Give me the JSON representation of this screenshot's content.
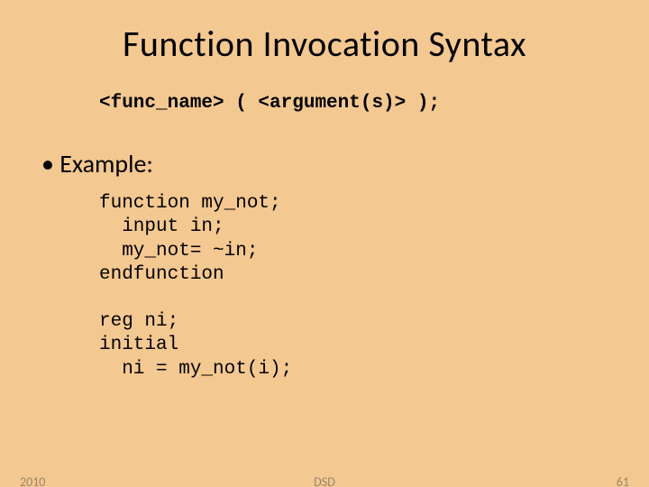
{
  "title": "Function Invocation Syntax",
  "syntax_line": "<func_name> ( <argument(s)> );",
  "bullet": "Example:",
  "code_block1": "function my_not;\n  input in;\n  my_not= ~in;\nendfunction",
  "code_block2": "reg ni;\ninitial\n  ni = my_not(i);",
  "footer": {
    "year": "2010",
    "center": "DSD",
    "page": "61"
  }
}
